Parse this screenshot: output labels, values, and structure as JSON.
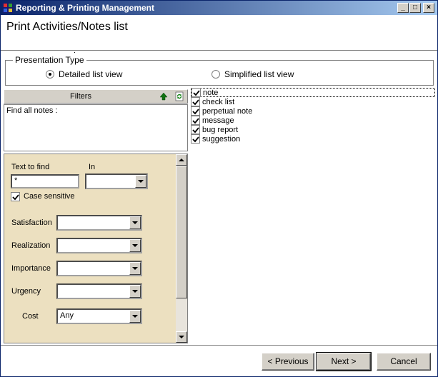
{
  "window": {
    "title": "Reporting & Printing Management",
    "minimize": "_",
    "maximize": "□",
    "close": "×"
  },
  "header": {
    "title": "Print Activities/Notes list"
  },
  "presentation": {
    "legend": "Presentation Type",
    "options": [
      {
        "label": "Detailed list view",
        "selected": true
      },
      {
        "label": "Simplified list view",
        "selected": false
      }
    ]
  },
  "filters": {
    "header_label": "Filters",
    "notes_text": "Find all notes :",
    "text_to_find_label": "Text to find",
    "text_to_find_value": "*",
    "in_label": "In",
    "in_value": "",
    "case_sensitive_label": "Case sensitive",
    "case_sensitive_checked": true,
    "fields": [
      {
        "label": "Satisfaction",
        "value": ""
      },
      {
        "label": "Realization",
        "value": ""
      },
      {
        "label": "Importance",
        "value": ""
      },
      {
        "label": "Urgency",
        "value": ""
      },
      {
        "label": "Cost",
        "value": "Any"
      }
    ]
  },
  "note_types": [
    {
      "label": "note",
      "checked": true
    },
    {
      "label": "check list",
      "checked": true
    },
    {
      "label": "perpetual note",
      "checked": true
    },
    {
      "label": "message",
      "checked": true
    },
    {
      "label": "bug report",
      "checked": true
    },
    {
      "label": "suggestion",
      "checked": true
    }
  ],
  "footer": {
    "previous_label": "< Previous",
    "next_label": "Next >",
    "cancel_label": "Cancel"
  },
  "colors": {
    "titlebar_start": "#0a246a",
    "titlebar_end": "#a6caf0",
    "filter_panel_bg": "#ece0c0",
    "button_face": "#d4d0c8"
  }
}
